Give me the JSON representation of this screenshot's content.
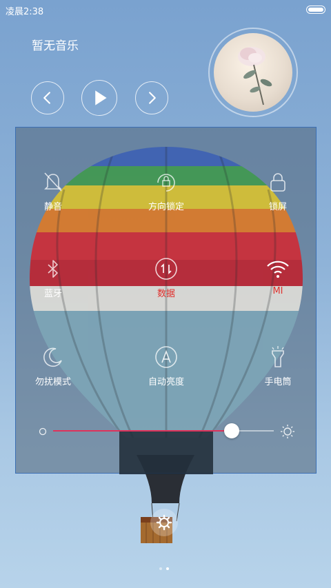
{
  "status_bar": {
    "time": "凌晨2:38"
  },
  "music": {
    "title": "暂无音乐",
    "controls": [
      {
        "name": "previous",
        "icon": "chevron-left-icon"
      },
      {
        "name": "play",
        "icon": "play-icon"
      },
      {
        "name": "next",
        "icon": "chevron-right-icon"
      }
    ]
  },
  "toggles": [
    {
      "id": "silent",
      "label": "静音",
      "icon": "bell-off-icon",
      "active": false
    },
    {
      "id": "rotation-lock",
      "label": "方向锁定",
      "icon": "rotation-lock-icon",
      "active": false
    },
    {
      "id": "lock-screen",
      "label": "锁屏",
      "icon": "lock-icon",
      "active": false
    },
    {
      "id": "bluetooth",
      "label": "蓝牙",
      "icon": "bluetooth-icon",
      "active": false
    },
    {
      "id": "data",
      "label": "数据",
      "icon": "data-transfer-icon",
      "active": false,
      "label_color": "#e0312d"
    },
    {
      "id": "wifi",
      "label": "MI",
      "icon": "wifi-icon",
      "active": true,
      "label_color": "#e0312d"
    },
    {
      "id": "do-not-disturb",
      "label": "勿扰模式",
      "icon": "moon-icon",
      "active": false
    },
    {
      "id": "auto-brightness",
      "label": "自动亮度",
      "icon": "auto-a-icon",
      "active": false
    },
    {
      "id": "flashlight",
      "label": "手电筒",
      "icon": "flashlight-icon",
      "active": false
    }
  ],
  "brightness": {
    "level_fraction": 0.81,
    "low_icon": "brightness-low-icon",
    "high_icon": "sun-icon"
  },
  "page_indicator": {
    "count": 2,
    "active_index": 1
  },
  "colors": {
    "accent_red": "#e0312d",
    "slider_fill": "#e0315a",
    "panel_border": "#3b6fb3"
  }
}
